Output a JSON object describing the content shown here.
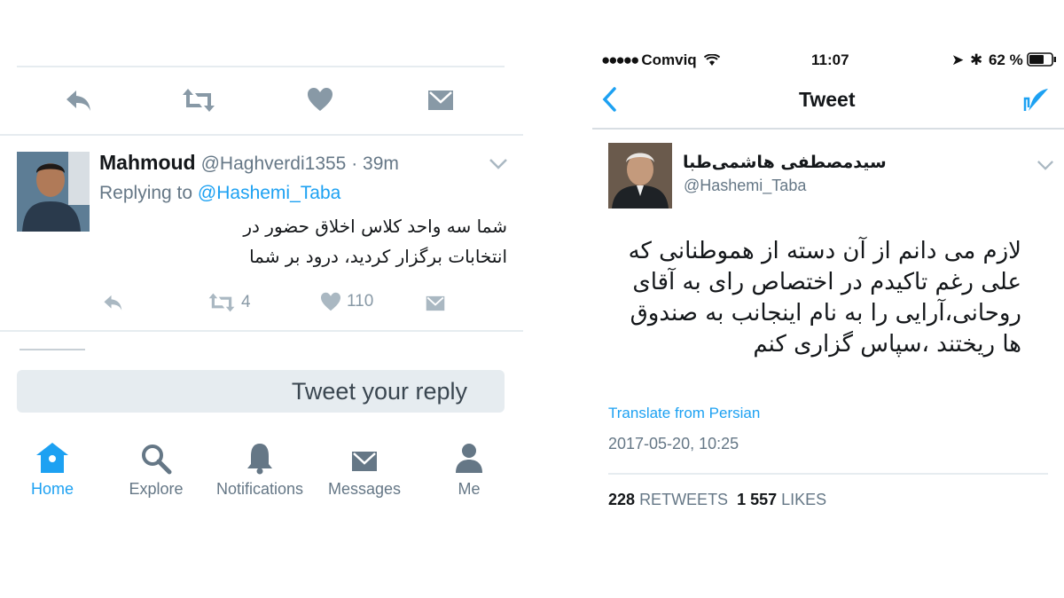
{
  "left": {
    "reply": {
      "name": "Mahmoud",
      "handle_time": "@Haghverdi1355 · 39m",
      "replying_prefix": "Replying to",
      "replying_mention": "@Hashemi_Taba",
      "text": "شما سه واحد کلاس اخلاق حضور در انتخابات برگزار کردید، درود بر شما",
      "retweets": "4",
      "likes": "110"
    },
    "compose": {
      "placeholder": "Tweet your reply"
    },
    "tabs": [
      {
        "label": "Home",
        "icon": "home-icon"
      },
      {
        "label": "Explore",
        "icon": "search-icon"
      },
      {
        "label": "Notifications",
        "icon": "bell-icon"
      },
      {
        "label": "Messages",
        "icon": "envelope-icon"
      },
      {
        "label": "Me",
        "icon": "person-icon"
      }
    ]
  },
  "right": {
    "statusbar": {
      "carrier": "Comviq",
      "time": "11:07",
      "battery": "62 %"
    },
    "nav": {
      "title": "Tweet"
    },
    "tweet": {
      "name": "سیدمصطفی هاشمی‌طبا",
      "handle": "@Hashemi_Taba",
      "text": "لازم می دانم از آن دسته از هموطنانی که علی رغم تاکیدم در اختصاص رای به آقای روحانی،آرایی را به نام اینجانب به صندوق ها ریختند ،سپاس گزاری کنم",
      "translate": "Translate from Persian",
      "timestamp": "2017-05-20, 10:25",
      "retweets_count": "228",
      "retweets_label": "RETWEETS",
      "likes_count": "1 557",
      "likes_label": "LIKES"
    }
  },
  "colors": {
    "accent": "#1da1f2",
    "muted": "#8899a6",
    "divider": "#e6ecf0",
    "text": "#14171a"
  }
}
